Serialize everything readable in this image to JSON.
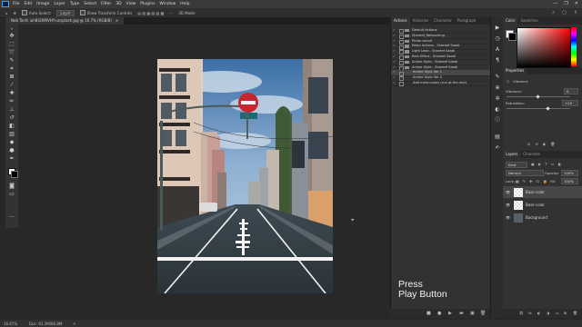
{
  "menubar": {
    "items": [
      "File",
      "Edit",
      "Image",
      "Layer",
      "Type",
      "Select",
      "Filter",
      "3D",
      "View",
      "Plugins",
      "Window",
      "Help"
    ],
    "window_controls": [
      "—",
      "❐",
      "✕"
    ]
  },
  "options": {
    "auto_select_label": "Auto-Select:",
    "auto_select_value": "Layer",
    "show_transform_label": "Show Transform Controls",
    "right_text": "3D Mode:"
  },
  "document": {
    "tab_title": "Nob Tachi iuh8SO9RVHY-unsplash.jpg @ 16.7% (RGB/8)",
    "close_glyph": "×"
  },
  "status": {
    "zoom": "16.67%",
    "doc_info": "Doc: 91.2M/66.8M",
    "arrow": ">"
  },
  "actions_panel": {
    "tabs": [
      "Actions",
      "Histories",
      "Character",
      "Paragraph"
    ],
    "items": [
      {
        "label": "Default Actions",
        "type": "folder"
      },
      {
        "label": "Shareef_Retouching",
        "type": "folder"
      },
      {
        "label": "Photo vscod",
        "type": "folder"
      },
      {
        "label": "Retro Actions - Shareef Saadi",
        "type": "folder"
      },
      {
        "label": "Light Leak - Shareef Saadi",
        "type": "folder"
      },
      {
        "label": "Rain Effect - Shareef Saadi",
        "type": "folder"
      },
      {
        "label": "Anime Style - Shareef Saadi",
        "type": "folder"
      },
      {
        "label": "Anime Style - Shareef Saadi",
        "type": "folder"
      },
      {
        "label": "Anime Style Ver 1",
        "type": "action",
        "selected": true
      },
      {
        "label": "Anime Style Ver 2",
        "type": "action"
      },
      {
        "label": "Add more colors (run at the end)",
        "type": "action"
      }
    ],
    "press_line1": "Press",
    "press_line2": "Play Button",
    "footer": [
      "■",
      "●",
      "▶",
      "▬",
      "▣",
      "🗑"
    ]
  },
  "color_panel": {
    "tabs": [
      "Color",
      "Swatches"
    ]
  },
  "properties_panel": {
    "tab": "Properties",
    "adjustment": "Vibrance",
    "vibrance_label": "Vibrance:",
    "vibrance_value": "0",
    "saturation_label": "Saturation:",
    "saturation_value": "+20"
  },
  "layers_panel": {
    "tabs": [
      "Layers",
      "Channels"
    ],
    "kind_label": "Kind",
    "blend_mode": "Normal",
    "opacity_label": "Opacity:",
    "opacity_value": "100%",
    "lock_label": "Lock:",
    "fill_label": "Fill:",
    "fill_value": "100%",
    "layers": [
      {
        "name": "Base color",
        "selected": true
      },
      {
        "name": "Base color",
        "selected": false
      },
      {
        "name": "Background",
        "selected": false
      }
    ],
    "footer": [
      "⛓",
      "fx",
      "◐",
      "◑",
      "▭",
      "⊞",
      "🗑"
    ]
  },
  "colors": {
    "ui_dark": "#282828",
    "panel": "#323232",
    "selection": "#474747",
    "accent": "#31a8ff"
  }
}
